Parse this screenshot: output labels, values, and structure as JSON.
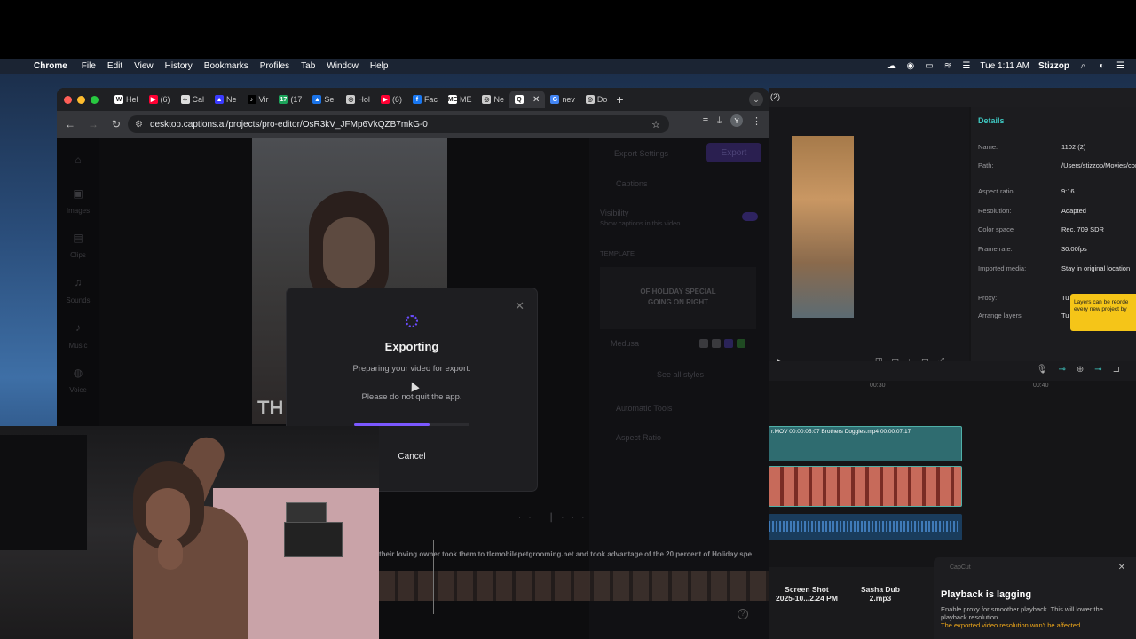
{
  "menubar": {
    "app": "Chrome",
    "items": [
      "File",
      "Edit",
      "View",
      "History",
      "Bookmarks",
      "Profiles",
      "Tab",
      "Window",
      "Help"
    ],
    "clock": "Tue 1:11 AM",
    "user": "Stizzop"
  },
  "chrome": {
    "tabs": [
      {
        "label": "Hel",
        "color": "#ffffff",
        "glyph": "W"
      },
      {
        "label": "(6)",
        "color": "#ff0033",
        "glyph": "▶"
      },
      {
        "label": "Cal",
        "color": "#dddddd",
        "glyph": "∞"
      },
      {
        "label": "Ne",
        "color": "#3b3bff",
        "glyph": "▲"
      },
      {
        "label": "Vir",
        "color": "#000000",
        "glyph": "♪"
      },
      {
        "label": "(17",
        "color": "#1ca35a",
        "glyph": "17"
      },
      {
        "label": "Sel",
        "color": "#1a73e8",
        "glyph": "▲"
      },
      {
        "label": "Hol",
        "color": "#cccccc",
        "glyph": "◎"
      },
      {
        "label": "(6)",
        "color": "#ff0033",
        "glyph": "▶"
      },
      {
        "label": "Fac",
        "color": "#1877f2",
        "glyph": "f"
      },
      {
        "label": "ME",
        "color": "#ffffff",
        "glyph": "ME"
      },
      {
        "label": "Ne",
        "color": "#cccccc",
        "glyph": "◎"
      },
      {
        "label": "",
        "color": "#ffffff",
        "glyph": "Q",
        "active": true
      },
      {
        "label": "nev",
        "color": "#4285f4",
        "glyph": "G"
      },
      {
        "label": "Do",
        "color": "#cccccc",
        "glyph": "◎"
      }
    ],
    "url": "desktop.captions.ai/projects/pro-editor/OsR3kV_JFMp6VkQZB7mkG-0",
    "profile_initial": "Y"
  },
  "editor": {
    "nav": [
      "Images",
      "Clips",
      "Sounds",
      "Music",
      "Voice"
    ],
    "caption_preview": "TH",
    "export_settings": "Export Settings",
    "export_button": "Export",
    "captions": "Captions",
    "visibility": "Visibility",
    "visibility_sub": "Show captions in this video",
    "template_label": "TEMPLATE",
    "template_line1": "OF HOLIDAY SPECIAL",
    "template_line2": "GOING ON RIGHT",
    "style_name": "Medusa",
    "see_all": "See all styles",
    "automatic_tools": "Automatic Tools",
    "aspect_ratio": "Aspect Ratio",
    "caption_track": "their loving owner took them to tlcmobilepetgrooming.net and took advantage of the 20 percent of Holiday spe"
  },
  "modal": {
    "title": "Exporting",
    "subtitle": "Preparing your video for export.",
    "note": "Please do not quit the app.",
    "cancel": "Cancel",
    "progress": 0.65
  },
  "capcut": {
    "count": "(2)",
    "details_title": "Details",
    "details": [
      {
        "key": "Name:",
        "value": "1102 (2)"
      },
      {
        "key": "Path:",
        "value": "/Users/stizzop/Movies/com.lveditor.draft/1102"
      },
      {
        "key": "Aspect ratio:",
        "value": "9:16"
      },
      {
        "key": "Resolution:",
        "value": "Adapted"
      },
      {
        "key": "Color space",
        "value": "Rec. 709 SDR"
      },
      {
        "key": "Frame rate:",
        "value": "30.00fps"
      },
      {
        "key": "Imported media:",
        "value": "Stay in original location"
      },
      {
        "key": "Proxy:",
        "value": "Tu"
      },
      {
        "key": "Arrange layers",
        "value": "Tu"
      }
    ],
    "tooltip": "Layers can be reorde every new project by",
    "ruler": [
      "00:30",
      "00:40"
    ],
    "clip1_label": "r.MOV  00:00:05:07      Brothers Doggies.mp4  00:00:07:17",
    "bottom_items": [
      {
        "line1": "Screen Shot",
        "line2": "2025-10...2.24 PM"
      },
      {
        "line1": "Sasha Dub",
        "line2": "2.mp3"
      }
    ]
  },
  "notification": {
    "app": "CapCut",
    "title": "Playback is lagging",
    "body": "Enable proxy for smoother playback. This will lower the playback resolution.",
    "warning": "The exported video resolution won't be affected."
  }
}
